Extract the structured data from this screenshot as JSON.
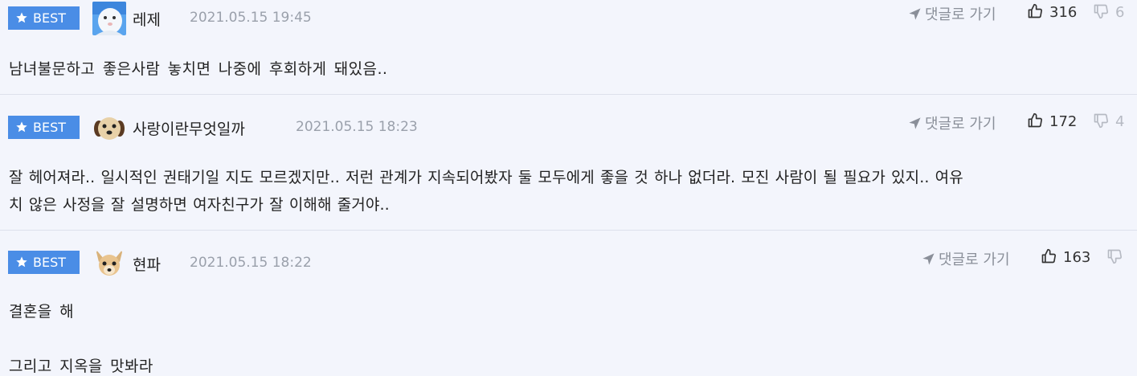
{
  "comments": [
    {
      "badge": "BEST",
      "author": "레제",
      "timestamp": "2021.05.15 19:45",
      "reply_label": "댓글로 가기",
      "likes": "316",
      "dislikes": "6",
      "body": [
        "남녀불문하고 좋은사람 놓치면 나중에 후회하게 돼있음.."
      ]
    },
    {
      "badge": "BEST",
      "author": "사랑이란무엇일까",
      "timestamp": "2021.05.15 18:23",
      "reply_label": "댓글로 가기",
      "likes": "172",
      "dislikes": "4",
      "body": [
        "잘 헤어져라.. 일시적인 권태기일 지도 모르겠지만.. 저런 관계가 지속되어봤자 둘 모두에게 좋을 것 하나 없더라. 모진 사람이 될 필요가 있지.. 여유",
        "치 않은 사정을 잘 설명하면 여자친구가 잘 이해해 줄거야.."
      ]
    },
    {
      "badge": "BEST",
      "author": "현파",
      "timestamp": "2021.05.15 18:22",
      "reply_label": "댓글로 가기",
      "likes": "163",
      "dislikes": "",
      "body": [
        "결혼을 해",
        "",
        "그리고 지옥을 맛봐라"
      ]
    }
  ],
  "colors": {
    "background": "#f3f5fc",
    "badge": "#4a8de6",
    "timestamp": "#9aa0ab",
    "divider": "#dde1ec"
  },
  "icons": {
    "badge": "star-icon",
    "reply": "arrow-pointer-icon",
    "like": "thumbs-up-icon",
    "dislike": "thumbs-down-icon"
  }
}
